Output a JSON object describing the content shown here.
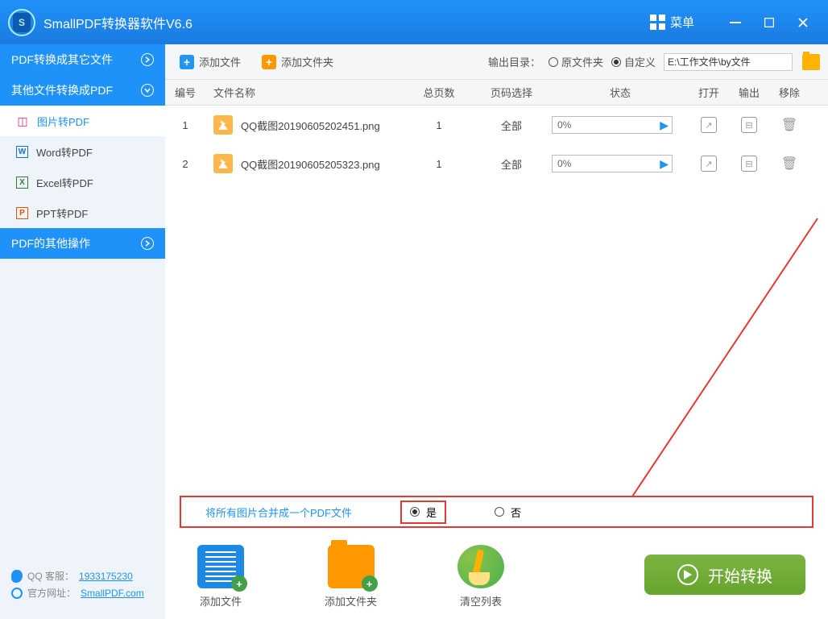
{
  "app": {
    "title": "SmallPDF转换器软件V6.6",
    "menu": "菜单"
  },
  "sidebar": {
    "section1": "PDF转换成其它文件",
    "section2": "其他文件转换成PDF",
    "section3": "PDF的其他操作",
    "items": [
      "图片转PDF",
      "Word转PDF",
      "Excel转PDF",
      "PPT转PDF"
    ],
    "qq_label": "QQ 客服：",
    "qq": "1933175230",
    "site_label": "官方网址：",
    "site": "SmallPDF.com"
  },
  "toolbar": {
    "add_file": "添加文件",
    "add_folder": "添加文件夹",
    "out_label": "输出目录：",
    "opt_src": "原文件夹",
    "opt_custom": "自定义",
    "out_path": "E:\\工作文件\\by文件"
  },
  "table": {
    "h_idx": "编号",
    "h_name": "文件名称",
    "h_pages": "总页数",
    "h_sel": "页码选择",
    "h_state": "状态",
    "h_open": "打开",
    "h_out": "输出",
    "h_del": "移除",
    "rows": [
      {
        "idx": "1",
        "name": "QQ截图20190605202451.png",
        "pages": "1",
        "sel": "全部",
        "pct": "0%"
      },
      {
        "idx": "2",
        "name": "QQ截图20190605205323.png",
        "pages": "1",
        "sel": "全部",
        "pct": "0%"
      }
    ]
  },
  "optbar": {
    "label": "将所有图片合并成一个PDF文件",
    "yes": "是",
    "no": "否"
  },
  "actions": {
    "add_file": "添加文件",
    "add_folder": "添加文件夹",
    "clear": "清空列表",
    "start": "开始转换"
  }
}
